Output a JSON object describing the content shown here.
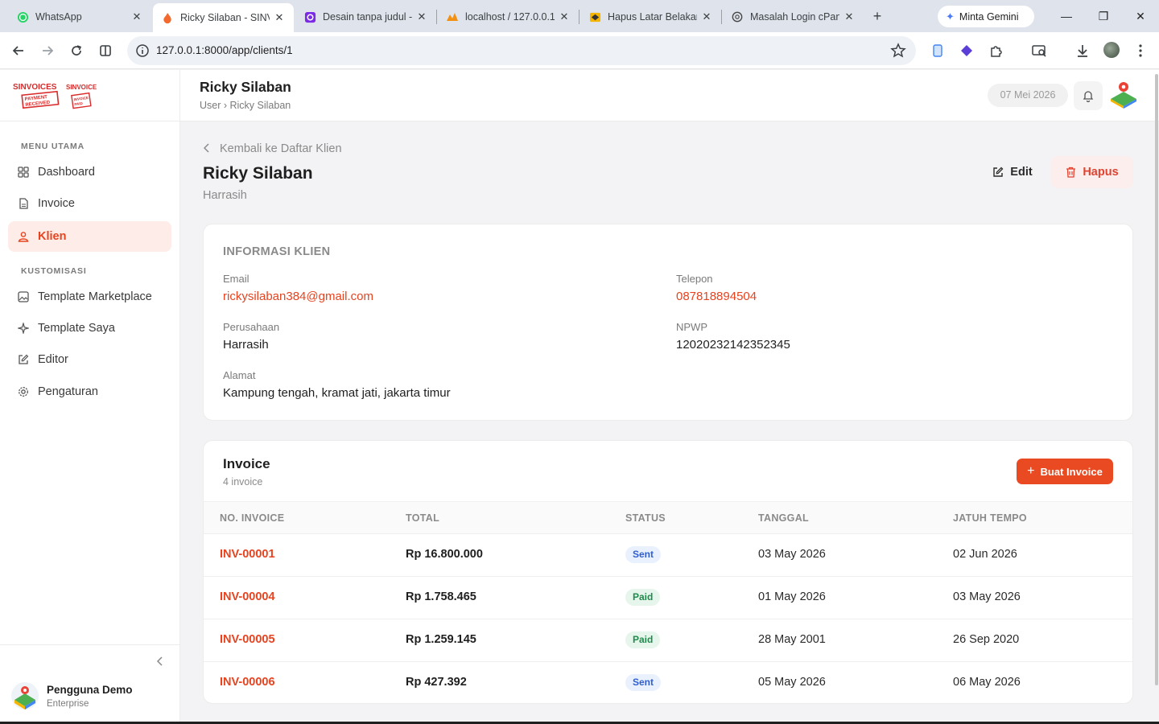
{
  "browser": {
    "tabs": [
      {
        "title": "WhatsApp",
        "active": false,
        "icon": "whatsapp-icon"
      },
      {
        "title": "Ricky Silaban - SINV",
        "active": true,
        "icon": "flame-icon"
      },
      {
        "title": "Desain tanpa judul -",
        "active": false,
        "icon": "canva-icon"
      },
      {
        "title": "localhost / 127.0.0.1",
        "active": false,
        "icon": "phpmyadmin-icon"
      },
      {
        "title": "Hapus Latar Belakan",
        "active": false,
        "icon": "removebg-icon"
      },
      {
        "title": "Masalah Login cPan",
        "active": false,
        "icon": "chatgpt-icon"
      }
    ],
    "gemini_label": "Minta Gemini",
    "url": "127.0.0.1:8000/app/clients/1",
    "extension_badge": "1"
  },
  "brand": {
    "accent": "#e8431f",
    "button": "#ea4a22"
  },
  "sidebar": {
    "section_main": "MENU UTAMA",
    "items_main": [
      {
        "label": "Dashboard",
        "icon": "grid-icon",
        "active": false
      },
      {
        "label": "Invoice",
        "icon": "document-icon",
        "active": false
      },
      {
        "label": "Klien",
        "icon": "users-icon",
        "active": true
      }
    ],
    "section_custom": "KUSTOMISASI",
    "items_custom": [
      {
        "label": "Template Marketplace",
        "icon": "image-icon"
      },
      {
        "label": "Template Saya",
        "icon": "sparkle-icon"
      },
      {
        "label": "Editor",
        "icon": "pencil-square-icon"
      },
      {
        "label": "Pengaturan",
        "icon": "gear-icon"
      }
    ],
    "user": {
      "name": "Pengguna Demo",
      "plan": "Enterprise"
    }
  },
  "header": {
    "title": "Ricky Silaban",
    "breadcrumb": "User › Ricky Silaban",
    "date": "07 Mei 2026"
  },
  "page": {
    "back_label": "Kembali ke Daftar Klien",
    "client_name": "Ricky Silaban",
    "company_sub": "Harrasih",
    "edit_label": "Edit",
    "delete_label": "Hapus"
  },
  "client_info": {
    "title": "INFORMASI KLIEN",
    "email_label": "Email",
    "email": "rickysilaban384@gmail.com",
    "phone_label": "Telepon",
    "phone": "087818894504",
    "company_label": "Perusahaan",
    "company": "Harrasih",
    "npwp_label": "NPWP",
    "npwp": "12020232142352345",
    "address_label": "Alamat",
    "address": "Kampung tengah, kramat jati, jakarta timur"
  },
  "invoices": {
    "title": "Invoice",
    "count": "4 invoice",
    "new_button": "Buat Invoice",
    "columns": [
      "NO. INVOICE",
      "TOTAL",
      "STATUS",
      "TANGGAL",
      "JATUH TEMPO"
    ],
    "rows": [
      {
        "no": "INV-00001",
        "total": "Rp 16.800.000",
        "status": "Sent",
        "date": "03 May 2026",
        "due": "02 Jun 2026"
      },
      {
        "no": "INV-00004",
        "total": "Rp 1.758.465",
        "status": "Paid",
        "date": "01 May 2026",
        "due": "03 May 2026"
      },
      {
        "no": "INV-00005",
        "total": "Rp 1.259.145",
        "status": "Paid",
        "date": "28 May 2001",
        "due": "26 Sep 2020"
      },
      {
        "no": "INV-00006",
        "total": "Rp 427.392",
        "status": "Sent",
        "date": "05 May 2026",
        "due": "06 May 2026"
      }
    ]
  }
}
